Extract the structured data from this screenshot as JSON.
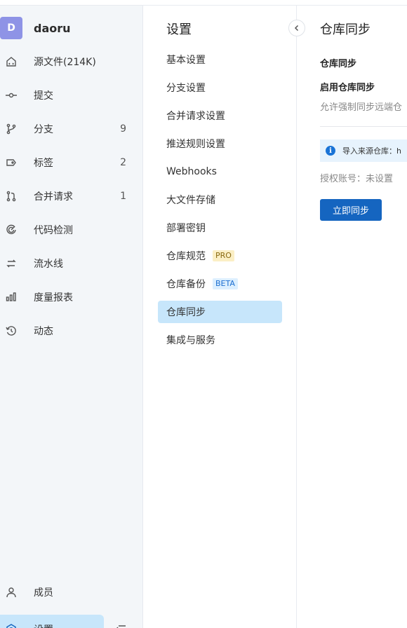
{
  "repo": {
    "avatar_letter": "D",
    "name": "daoru"
  },
  "nav": {
    "source": {
      "label": "源文件(214K)"
    },
    "commits": {
      "label": "提交"
    },
    "branches": {
      "label": "分支",
      "count": "9"
    },
    "tags": {
      "label": "标签",
      "count": "2"
    },
    "merge_requests": {
      "label": "合并请求",
      "count": "1"
    },
    "code_check": {
      "label": "代码检测"
    },
    "pipeline": {
      "label": "流水线"
    },
    "metrics": {
      "label": "度量报表"
    },
    "activity": {
      "label": "动态"
    }
  },
  "bottom_nav": {
    "members": {
      "label": "成员"
    },
    "settings": {
      "label": "设置"
    }
  },
  "settings_menu": {
    "title": "设置",
    "items": {
      "basic": "基本设置",
      "branch": "分支设置",
      "merge": "合并请求设置",
      "push_rules": "推送规则设置",
      "webhooks": "Webhooks",
      "lfs": "大文件存储",
      "deploy_keys": "部署密钥",
      "spec": "仓库规范",
      "spec_tag": "PRO",
      "backup": "仓库备份",
      "backup_tag": "BETA",
      "sync": "仓库同步",
      "integrations": "集成与服务"
    }
  },
  "content": {
    "title": "仓库同步",
    "section_title": "仓库同步",
    "enable_label": "启用仓库同步",
    "enable_desc": "允许强制同步远端仓",
    "info_text": "导入来源仓库：h",
    "auth_text": "授权账号：未设置",
    "sync_button": "立即同步"
  },
  "colors": {
    "accent": "#1565c0",
    "active_bg": "#c7e6fb",
    "avatar_bg": "#8e93e6"
  }
}
